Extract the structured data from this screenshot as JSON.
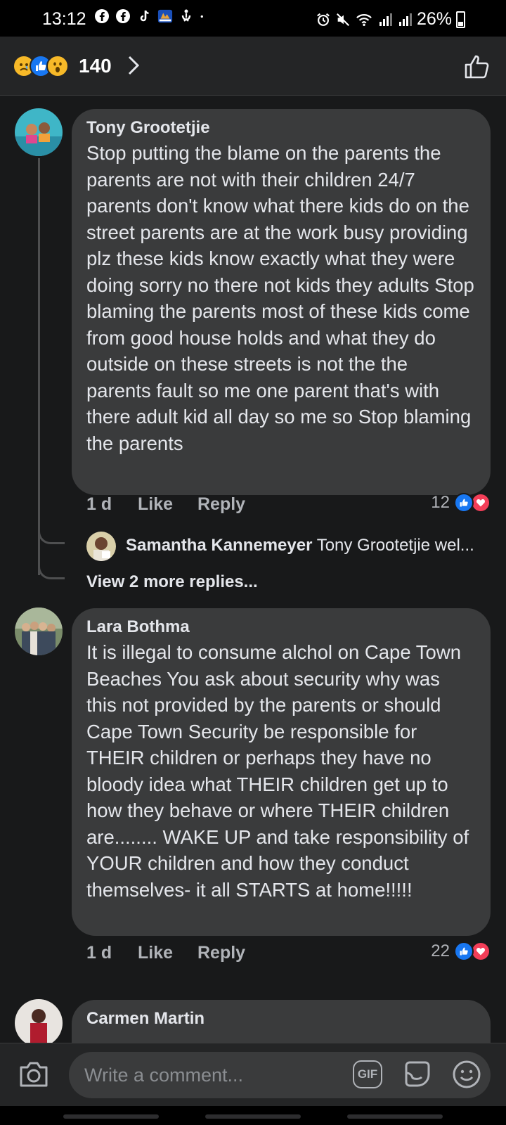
{
  "status_bar": {
    "time": "13:12",
    "battery": "26%",
    "left_icons": [
      "facebook-icon",
      "facebook-icon",
      "tiktok-icon",
      "news-app-icon",
      "accessibility-icon",
      "dot-icon"
    ],
    "right_icons": [
      "alarm-icon",
      "mute-icon",
      "wifi-icon",
      "signal-icon",
      "signal-icon",
      "battery-icon"
    ]
  },
  "reactions_header": {
    "count": "140",
    "icons": [
      "sad-reaction-icon",
      "like-reaction-icon",
      "wow-reaction-icon"
    ]
  },
  "comments": [
    {
      "author": "Tony Grootetjie",
      "text": "Stop putting the blame on the parents the parents are not with their children 24/7 parents don't know what there kids do on the street parents are at the work busy providing plz these kids know exactly what they were doing sorry no there not kids they adults Stop blaming the parents most of these kids come from good house holds and what they do outside on these streets is not the the parents fault so me one parent that's with there adult kid all day so me so Stop blaming the parents",
      "time": "1 d",
      "like_label": "Like",
      "reply_label": "Reply",
      "reaction_count": "12",
      "reply_preview": {
        "author": "Samantha Kannemeyer",
        "snippet": "Tony Grootetjie wel..."
      },
      "view_more": "View 2 more replies..."
    },
    {
      "author": "Lara Bothma",
      "text": "It is illegal to consume alchol on Cape Town Beaches You ask about security why was this not provided by the parents or should Cape Town Security be responsible for THEIR children or perhaps they have no bloody idea what THEIR children get up to how they behave or where THEIR children are........ WAKE UP and take responsibility of YOUR  children and how they conduct themselves- it all STARTS at home!!!!!",
      "time": "1 d",
      "like_label": "Like",
      "reply_label": "Reply",
      "reaction_count": "22"
    },
    {
      "author": "Carmen Martin"
    }
  ],
  "composer": {
    "placeholder": "Write a comment...",
    "gif_label": "GIF"
  },
  "colors": {
    "background": "#18191a",
    "bubble": "#3a3b3c",
    "like_blue": "#1877f2",
    "love_red": "#f33e58",
    "muted_text": "#b0b3b8"
  }
}
